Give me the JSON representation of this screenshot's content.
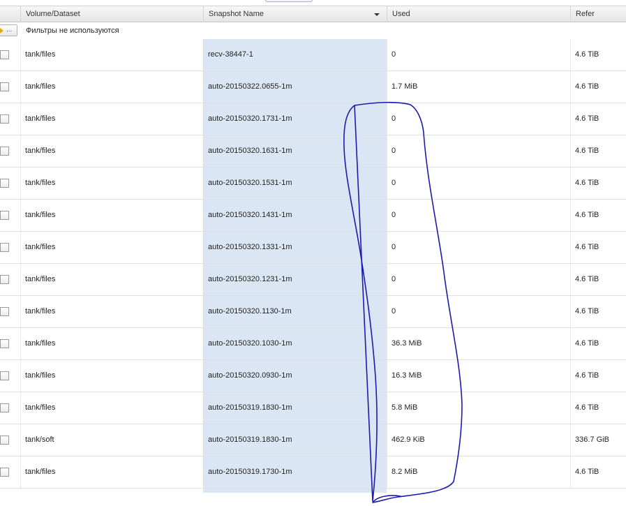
{
  "header": {
    "columns": [
      "Volume/Dataset",
      "Snapshot Name",
      "Used",
      "Refer"
    ]
  },
  "filter": {
    "button_label": "...",
    "status": "Фильтры не используются"
  },
  "icons": {
    "sort": "sort-descending-icon",
    "filter": "filter-arrow-icon"
  },
  "colors": {
    "highlight_column": "#dbe6f4",
    "annotation_ink": "#1a1ab0"
  },
  "rows": [
    {
      "dataset": "tank/files",
      "snapshot": "recv-38447-1",
      "used": "0",
      "refer": "4.6 TiB"
    },
    {
      "dataset": "tank/files",
      "snapshot": "auto-20150322.0655-1m",
      "used": "1.7 MiB",
      "refer": "4.6 TiB"
    },
    {
      "dataset": "tank/files",
      "snapshot": "auto-20150320.1731-1m",
      "used": "0",
      "refer": "4.6 TiB"
    },
    {
      "dataset": "tank/files",
      "snapshot": "auto-20150320.1631-1m",
      "used": "0",
      "refer": "4.6 TiB"
    },
    {
      "dataset": "tank/files",
      "snapshot": "auto-20150320.1531-1m",
      "used": "0",
      "refer": "4.6 TiB"
    },
    {
      "dataset": "tank/files",
      "snapshot": "auto-20150320.1431-1m",
      "used": "0",
      "refer": "4.6 TiB"
    },
    {
      "dataset": "tank/files",
      "snapshot": "auto-20150320.1331-1m",
      "used": "0",
      "refer": "4.6 TiB"
    },
    {
      "dataset": "tank/files",
      "snapshot": "auto-20150320.1231-1m",
      "used": "0",
      "refer": "4.6 TiB"
    },
    {
      "dataset": "tank/files",
      "snapshot": "auto-20150320.1130-1m",
      "used": "0",
      "refer": "4.6 TiB"
    },
    {
      "dataset": "tank/files",
      "snapshot": "auto-20150320.1030-1m",
      "used": "36.3 MiB",
      "refer": "4.6 TiB"
    },
    {
      "dataset": "tank/files",
      "snapshot": "auto-20150320.0930-1m",
      "used": "16.3 MiB",
      "refer": "4.6 TiB"
    },
    {
      "dataset": "tank/files",
      "snapshot": "auto-20150319.1830-1m",
      "used": "5.8 MiB",
      "refer": "4.6 TiB"
    },
    {
      "dataset": "tank/soft",
      "snapshot": "auto-20150319.1830-1m",
      "used": "462.9 KiB",
      "refer": "336.7 GiB"
    },
    {
      "dataset": "tank/files",
      "snapshot": "auto-20150319.1730-1m",
      "used": "8.2 MiB",
      "refer": "4.6 TiB"
    }
  ]
}
